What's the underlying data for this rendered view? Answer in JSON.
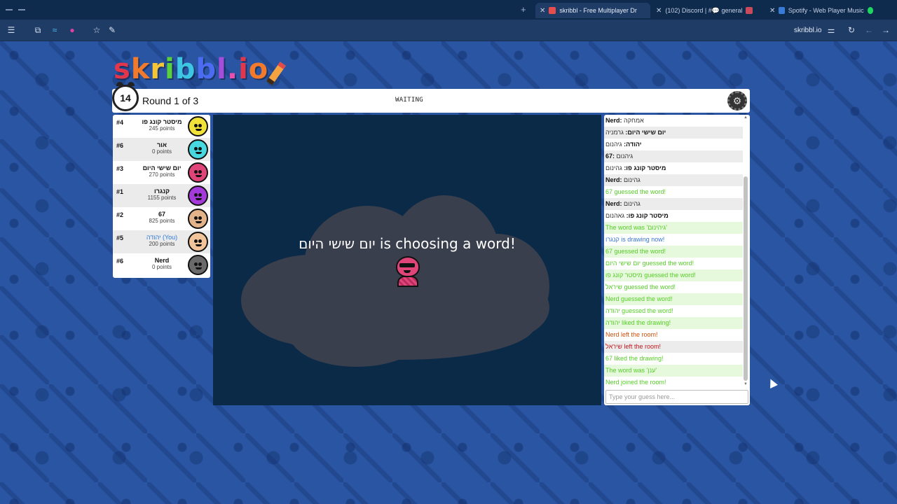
{
  "browser": {
    "tabs": [
      {
        "title": "skribbl - Free Multiplayer Dr",
        "active": true
      },
      {
        "title": "(102) Discord | #💬 general"
      },
      {
        "title": "Spotify - Web Player Music"
      }
    ],
    "address": "skribbl.io",
    "new_tab_label": "+",
    "close_glyph": "✕"
  },
  "logo": {
    "text": "skribbl.io",
    "colors": [
      "#e2364d",
      "#f47a2b",
      "#f7c636",
      "#5ad13c",
      "#3dc5e4",
      "#4b6cf0",
      "#a64ddb",
      "#ea4fb0",
      "#e2364d",
      "#f47a2b"
    ]
  },
  "header": {
    "timer": "14",
    "round": "Round 1 of 3",
    "status": "WAITING",
    "settings_icon": "gear-icon"
  },
  "players": [
    {
      "rank": "#4",
      "name": "מיסטר קונג פו",
      "points": "245 points",
      "you": false,
      "color": "#f1e23a"
    },
    {
      "rank": "#6",
      "name": "אור",
      "points": "0 points",
      "you": false,
      "color": "#47d8e0"
    },
    {
      "rank": "#3",
      "name": "יום שישי היום",
      "points": "270 points",
      "you": false,
      "color": "#e0457a"
    },
    {
      "rank": "#1",
      "name": "קנגרו",
      "points": "1155 points",
      "you": false,
      "color": "#a33ad9"
    },
    {
      "rank": "#2",
      "name": "67",
      "points": "825 points",
      "you": false,
      "color": "#e3b38a"
    },
    {
      "rank": "#5",
      "name": "יהודה (You)",
      "points": "200 points",
      "you": true,
      "color": "#f2c49a"
    },
    {
      "rank": "#6",
      "name": "Nerd",
      "points": "0 points",
      "you": false,
      "color": "#6a6a6a"
    }
  ],
  "canvas": {
    "message": "יום שישי היום is choosing a word!"
  },
  "chat": {
    "messages": [
      {
        "who": "Nerd:",
        "text": "אמחקה",
        "type": "normal"
      },
      {
        "who": "יום שישי היום:",
        "text": "גרמניה",
        "type": "normal"
      },
      {
        "who": "יהודה:",
        "text": "גיהנום",
        "type": "normal"
      },
      {
        "who": "67:",
        "text": "גיהנום",
        "type": "normal"
      },
      {
        "who": "מיסטר קונג פו:",
        "text": "גהינום",
        "type": "normal"
      },
      {
        "who": "Nerd:",
        "text": "גהינום",
        "type": "normal"
      },
      {
        "who": "",
        "text": "67 guessed the word!",
        "type": "green"
      },
      {
        "who": "Nerd:",
        "text": "גהינום",
        "type": "normal"
      },
      {
        "who": "מיסטר קונג פו:",
        "text": "גאהנום",
        "type": "normal"
      },
      {
        "who": "",
        "text": "The word was 'גיהינום'",
        "type": "green"
      },
      {
        "who": "",
        "text": "קנגרו is drawing now!",
        "type": "blue"
      },
      {
        "who": "",
        "text": "67 guessed the word!",
        "type": "green"
      },
      {
        "who": "",
        "text": "יום שישי היום guessed the word!",
        "type": "green"
      },
      {
        "who": "",
        "text": "מיסטר קונג פו guessed the word!",
        "type": "green"
      },
      {
        "who": "",
        "text": "שיראל guessed the word!",
        "type": "green"
      },
      {
        "who": "",
        "text": "Nerd guessed the word!",
        "type": "green"
      },
      {
        "who": "",
        "text": "יהודה guessed the word!",
        "type": "green"
      },
      {
        "who": "",
        "text": "יהודה liked the drawing!",
        "type": "green"
      },
      {
        "who": "",
        "text": "Nerd left the room!",
        "type": "red"
      },
      {
        "who": "",
        "text": "שיראל left the room!",
        "type": "redd"
      },
      {
        "who": "",
        "text": "67 liked the drawing!",
        "type": "green"
      },
      {
        "who": "",
        "text": "The word was 'ענן'",
        "type": "green"
      },
      {
        "who": "",
        "text": "Nerd joined the room!",
        "type": "green"
      }
    ],
    "input_placeholder": "Type your guess here..."
  }
}
